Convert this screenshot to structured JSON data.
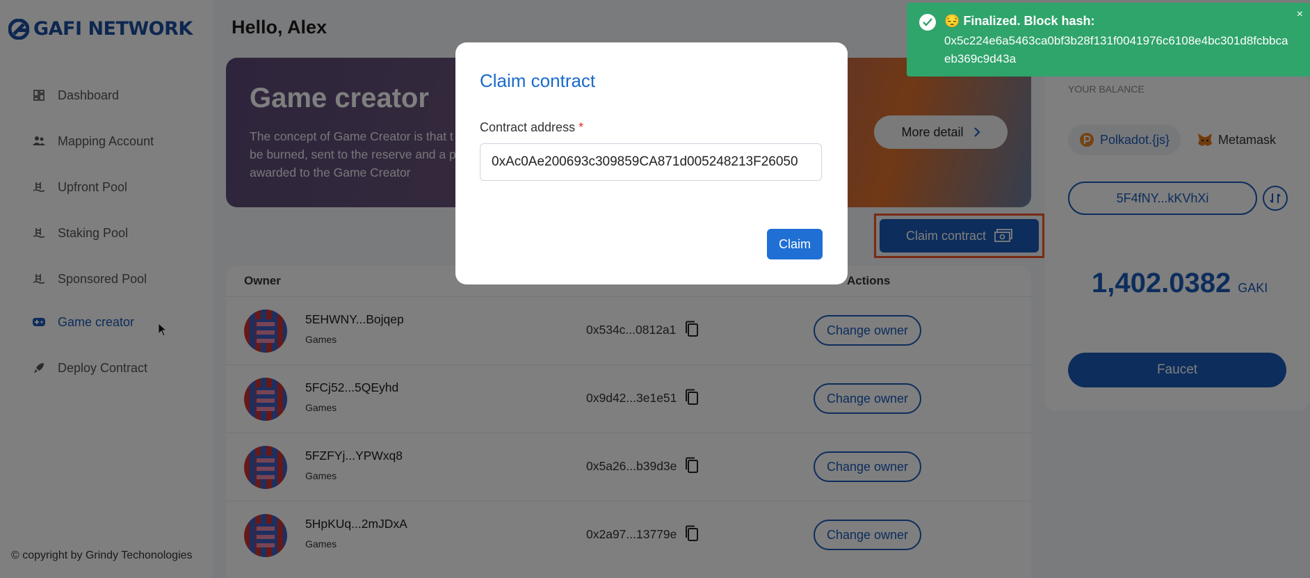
{
  "brand": {
    "name": "GAFI NETWORK"
  },
  "sidebar": {
    "items": [
      {
        "label": "Dashboard",
        "icon": "dashboard-icon"
      },
      {
        "label": "Mapping Account",
        "icon": "users-icon"
      },
      {
        "label": "Upfront Pool",
        "icon": "pool-icon"
      },
      {
        "label": "Staking Pool",
        "icon": "pool-icon"
      },
      {
        "label": "Sponsored Pool",
        "icon": "pool-icon"
      },
      {
        "label": "Game creator",
        "icon": "gamepad-icon",
        "active": true
      },
      {
        "label": "Deploy Contract",
        "icon": "rocket-icon"
      }
    ],
    "copyright": "© copyright by Grindy Techonologies"
  },
  "header": {
    "greeting": "Hello, Alex"
  },
  "banner": {
    "title": "Game creator",
    "description": "The concept of Game Creator is that t be burned, sent to the reserve and a p awarded to the Game Creator",
    "more_detail": "More detail"
  },
  "toolbar": {
    "claim_contract": "Claim contract"
  },
  "table": {
    "headers": {
      "owner": "Owner",
      "actions": "Actions"
    },
    "rows": [
      {
        "owner": "5EHWNY...Bojqep",
        "category": "Games",
        "address": "0x534c...0812a1",
        "action": "Change owner"
      },
      {
        "owner": "5FCj52...5QEyhd",
        "category": "Games",
        "address": "0x9d42...3e1e51",
        "action": "Change owner"
      },
      {
        "owner": "5FZFYj...YPWxq8",
        "category": "Games",
        "address": "0x5a26...b39d3e",
        "action": "Change owner"
      },
      {
        "owner": "5HpKUq...2mJDxA",
        "category": "Games",
        "address": "0x2a97...13779e",
        "action": "Change owner"
      }
    ]
  },
  "wallet": {
    "balance_label": "YOUR BALANCE",
    "polkadot": "Polkadot.{js}",
    "metamask": "Metamask",
    "account": "5F4fNY...kKVhXi",
    "balance": "1,402.0382",
    "unit": "GAKI",
    "faucet": "Faucet"
  },
  "modal": {
    "title": "Claim contract",
    "field_label": "Contract address",
    "required_mark": "*",
    "field_value": "0xAc0Ae200693c309859CA871d005248213F26050",
    "claim": "Claim"
  },
  "toast": {
    "emoji": "😔",
    "title": "Finalized. Block hash:",
    "hash": "0x5c224e6a5463ca0bf3b28f131f0041976c6108e4bc301d8fcbbcaeb369c9d43a",
    "close": "×"
  },
  "colors": {
    "brand": "#1a5ab8",
    "highlight": "#f0542a",
    "toast": "#2fa46b"
  }
}
